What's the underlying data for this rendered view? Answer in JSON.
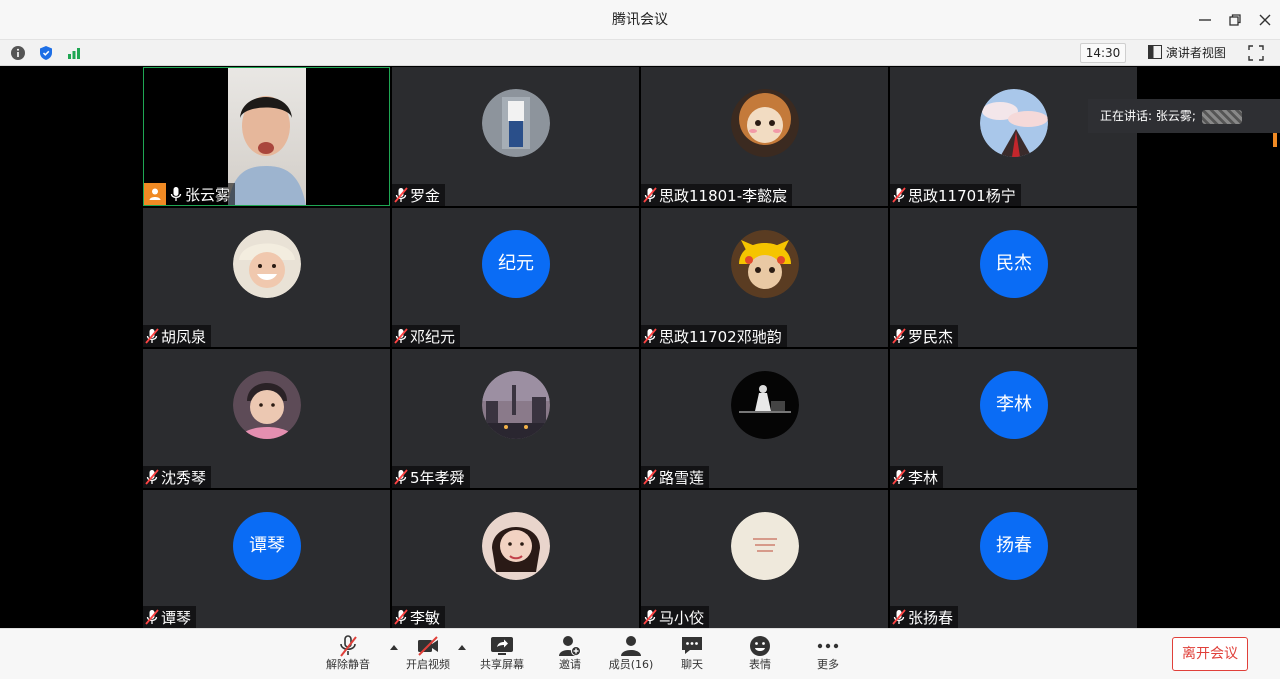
{
  "window": {
    "title": "腾讯会议"
  },
  "toolbar": {
    "time": "14:30",
    "speaker_view_label": "演讲者视图"
  },
  "speaking": {
    "prefix": "正在讲话: 张云雾;"
  },
  "participants": [
    {
      "name": "张云雾",
      "avatar": "video",
      "host": true,
      "muted": false
    },
    {
      "name": "罗金",
      "avatar": "photo",
      "muted": true
    },
    {
      "name": "思政11801-李懿宸",
      "avatar": "photo",
      "muted": true
    },
    {
      "name": "思政11701杨宁",
      "avatar": "photo",
      "muted": true
    },
    {
      "name": "胡凤泉",
      "avatar": "photo",
      "muted": true
    },
    {
      "name": "邓纪元",
      "avatar": "text",
      "avatar_text": "纪元",
      "muted": true
    },
    {
      "name": "思政11702邓驰韵",
      "avatar": "photo",
      "muted": true
    },
    {
      "name": "罗民杰",
      "avatar": "text",
      "avatar_text": "民杰",
      "muted": true
    },
    {
      "name": "沈秀琴",
      "avatar": "photo",
      "muted": true
    },
    {
      "name": "5年孝舜",
      "avatar": "photo",
      "muted": true
    },
    {
      "name": "路雪莲",
      "avatar": "photo",
      "muted": true
    },
    {
      "name": "李林",
      "avatar": "text",
      "avatar_text": "李林",
      "muted": true
    },
    {
      "name": "谭琴",
      "avatar": "text",
      "avatar_text": "谭琴",
      "muted": true
    },
    {
      "name": "李敏",
      "avatar": "photo",
      "muted": true
    },
    {
      "name": "马小佼",
      "avatar": "photo",
      "muted": true
    },
    {
      "name": "张扬春",
      "avatar": "text",
      "avatar_text": "扬春",
      "muted": true
    }
  ],
  "controls": {
    "unmute": "解除静音",
    "start_video": "开启视频",
    "share_screen": "共享屏幕",
    "invite": "邀请",
    "members": "成员(16)",
    "chat": "聊天",
    "reactions": "表情",
    "more": "更多",
    "leave": "离开会议"
  },
  "colors": {
    "avatar_blue": "#0a6cf5",
    "host_orange": "#f08a24",
    "leave_red": "#e0403a",
    "active_border": "#1fa653"
  }
}
